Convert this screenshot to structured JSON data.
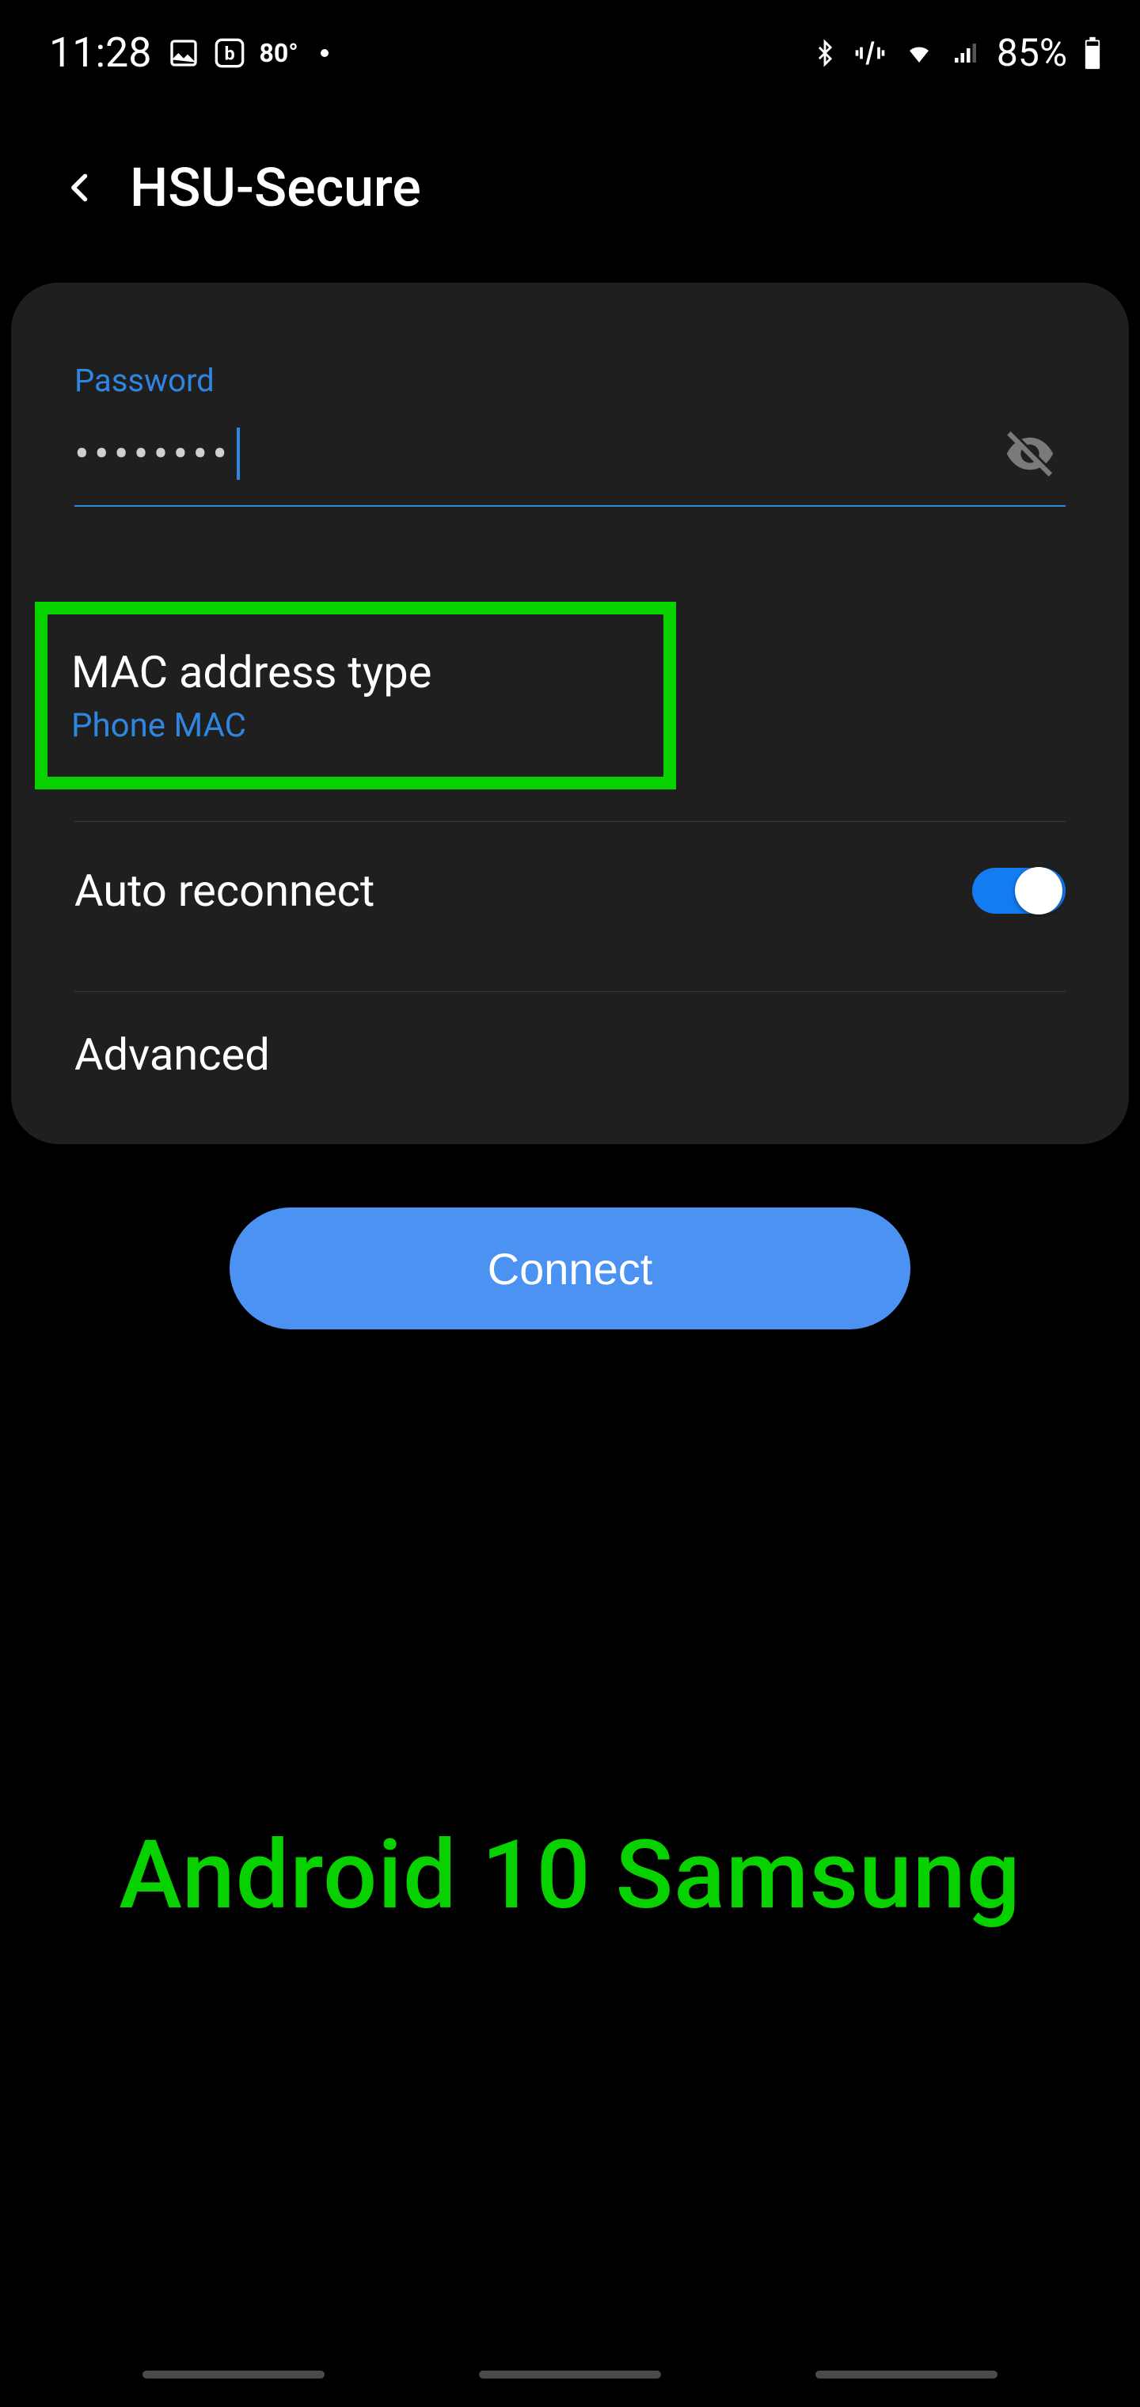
{
  "status": {
    "time": "11:28",
    "temp": "80°",
    "battery": "85%"
  },
  "header": {
    "title": "HSU-Secure"
  },
  "password": {
    "label": "Password",
    "value": "••••••••"
  },
  "mac": {
    "title": "MAC address type",
    "value": "Phone MAC"
  },
  "auto_reconnect": {
    "label": "Auto reconnect",
    "on": true
  },
  "advanced": {
    "label": "Advanced"
  },
  "connect": {
    "label": "Connect"
  },
  "annotation": "Android 10 Samsung"
}
